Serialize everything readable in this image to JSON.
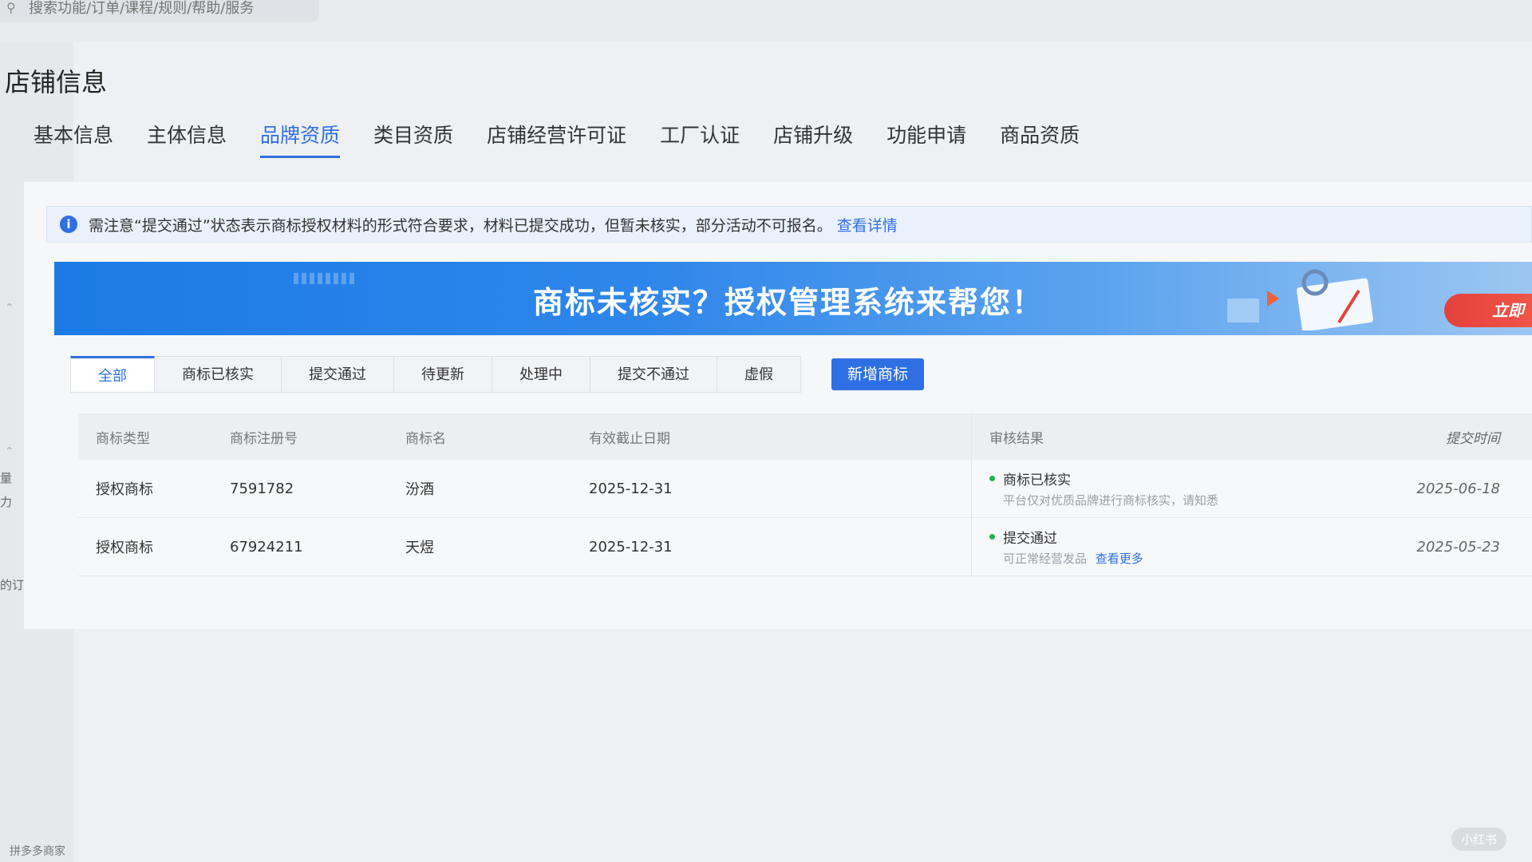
{
  "search": {
    "placeholder": "搜索功能/订单/课程/规则/帮助/服务"
  },
  "left_rail": {
    "items": [
      "量",
      "力",
      "的订单"
    ],
    "footer": "拼多多商家"
  },
  "page_title": "店铺信息",
  "main_tabs": [
    {
      "label": "基本信息",
      "active": false
    },
    {
      "label": "主体信息",
      "active": false
    },
    {
      "label": "品牌资质",
      "active": true
    },
    {
      "label": "类目资质",
      "active": false
    },
    {
      "label": "店铺经营许可证",
      "active": false
    },
    {
      "label": "工厂认证",
      "active": false
    },
    {
      "label": "店铺升级",
      "active": false
    },
    {
      "label": "功能申请",
      "active": false
    },
    {
      "label": "商品资质",
      "active": false
    }
  ],
  "notice": {
    "text": "需注意“提交通过”状态表示商标授权材料的形式符合要求，材料已提交成功，但暂未核实，部分活动不可报名。",
    "link": "查看详情"
  },
  "banner": {
    "headline": "商标未核实？授权管理系统来帮您！",
    "cta": "立即"
  },
  "filters": {
    "tabs": [
      "全部",
      "商标已核实",
      "提交通过",
      "待更新",
      "处理中",
      "提交不通过",
      "虚假"
    ],
    "active_index": 0,
    "add_button": "新增商标"
  },
  "table": {
    "headers": [
      "商标类型",
      "商标注册号",
      "商标名",
      "有效截止日期",
      "审核结果",
      "提交时间"
    ],
    "rows": [
      {
        "type": "授权商标",
        "reg_no": "7591782",
        "name": "汾酒",
        "expiry": "2025-12-31",
        "status": "商标已核实",
        "status_desc": "平台仅对优质品牌进行商标核实，请知悉",
        "status_link": "",
        "submitted": "2025-06-18"
      },
      {
        "type": "授权商标",
        "reg_no": "67924211",
        "name": "天煜",
        "expiry": "2025-12-31",
        "status": "提交通过",
        "status_desc": "可正常经营发品",
        "status_link": "查看更多",
        "submitted": "2025-05-23"
      }
    ]
  },
  "watermark": "小红书",
  "colors": {
    "accent": "#2f6fe4",
    "success": "#22b14c",
    "cta": "#e4413b"
  }
}
